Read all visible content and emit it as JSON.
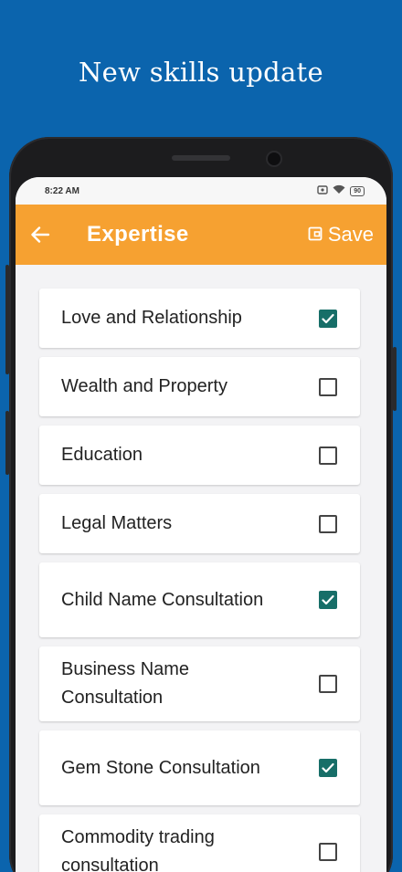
{
  "promo": {
    "title": "New skills update"
  },
  "status_bar": {
    "time": "8:22 AM",
    "battery": "90"
  },
  "app_bar": {
    "title": "Expertise",
    "save_label": "Save"
  },
  "colors": {
    "background": "#0b64ad",
    "app_bar": "#f6a131",
    "checkbox_checked": "#176e68"
  },
  "expertise_items": [
    {
      "label": "Love and Relationship",
      "checked": true
    },
    {
      "label": "Wealth and Property",
      "checked": false
    },
    {
      "label": "Education",
      "checked": false
    },
    {
      "label": "Legal Matters",
      "checked": false
    },
    {
      "label": "Child Name Consultation",
      "checked": true
    },
    {
      "label": "Business Name Consultation",
      "checked": false
    },
    {
      "label": "Gem Stone Consultation",
      "checked": true
    },
    {
      "label": "Commodity trading consultation",
      "checked": false
    }
  ]
}
